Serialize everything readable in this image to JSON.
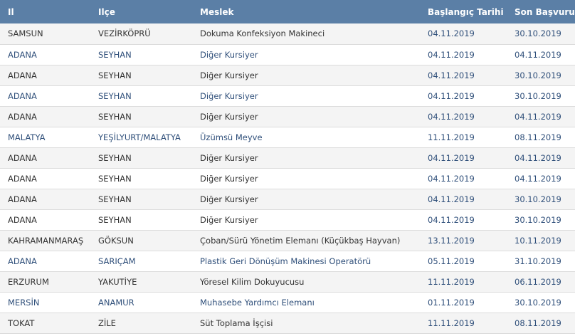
{
  "table": {
    "headers": [
      "Il",
      "Ilçe",
      "Meslek",
      "Başlangıç Tarihi",
      "Son Başvuru T"
    ],
    "rows": [
      {
        "il": "SAMSUN",
        "ilce": "VEZİRKÖPRÜ",
        "meslek": "Dokuma Konfeksiyon Makineci",
        "baslangic": "04.11.2019",
        "son_basvuru": "30.10.2019",
        "style": "dark"
      },
      {
        "il": "ADANA",
        "ilce": "SEYHAN",
        "meslek": "Diğer Kursiyer",
        "baslangic": "04.11.2019",
        "son_basvuru": "04.11.2019",
        "style": "link"
      },
      {
        "il": "ADANA",
        "ilce": "SEYHAN",
        "meslek": "Diğer Kursiyer",
        "baslangic": "04.11.2019",
        "son_basvuru": "30.10.2019",
        "style": "dark"
      },
      {
        "il": "ADANA",
        "ilce": "SEYHAN",
        "meslek": "Diğer Kursiyer",
        "baslangic": "04.11.2019",
        "son_basvuru": "30.10.2019",
        "style": "link"
      },
      {
        "il": "ADANA",
        "ilce": "SEYHAN",
        "meslek": "Diğer Kursiyer",
        "baslangic": "04.11.2019",
        "son_basvuru": "04.11.2019",
        "style": "dark"
      },
      {
        "il": "MALATYA",
        "ilce": "YEŞİLYURT/MALATYA",
        "meslek": "Üzümsü Meyve",
        "baslangic": "11.11.2019",
        "son_basvuru": "08.11.2019",
        "style": "link"
      },
      {
        "il": "ADANA",
        "ilce": "SEYHAN",
        "meslek": "Diğer Kursiyer",
        "baslangic": "04.11.2019",
        "son_basvuru": "04.11.2019",
        "style": "dark"
      },
      {
        "il": "ADANA",
        "ilce": "SEYHAN",
        "meslek": "Diğer Kursiyer",
        "baslangic": "04.11.2019",
        "son_basvuru": "04.11.2019",
        "style": "dark"
      },
      {
        "il": "ADANA",
        "ilce": "SEYHAN",
        "meslek": "Diğer Kursiyer",
        "baslangic": "04.11.2019",
        "son_basvuru": "30.10.2019",
        "style": "dark"
      },
      {
        "il": "ADANA",
        "ilce": "SEYHAN",
        "meslek": "Diğer Kursiyer",
        "baslangic": "04.11.2019",
        "son_basvuru": "30.10.2019",
        "style": "dark"
      },
      {
        "il": "KAHRAMANMARAŞ",
        "ilce": "GÖKSUN",
        "meslek": "Çoban/Sürü Yönetim Elemanı (Küçükbaş Hayvan)",
        "baslangic": "13.11.2019",
        "son_basvuru": "10.11.2019",
        "style": "dark"
      },
      {
        "il": "ADANA",
        "ilce": "SARIÇAM",
        "meslek": "Plastik Geri Dönüşüm Makinesi Operatörü",
        "baslangic": "05.11.2019",
        "son_basvuru": "31.10.2019",
        "style": "link"
      },
      {
        "il": "ERZURUM",
        "ilce": "YAKUTİYE",
        "meslek": "Yöresel Kilim Dokuyucusu",
        "baslangic": "11.11.2019",
        "son_basvuru": "06.11.2019",
        "style": "dark"
      },
      {
        "il": "MERSİN",
        "ilce": "ANAMUR",
        "meslek": "Muhasebe Yardımcı Elemanı",
        "baslangic": "01.11.2019",
        "son_basvuru": "30.10.2019",
        "style": "link"
      },
      {
        "il": "TOKAT",
        "ilce": "ZİLE",
        "meslek": "Süt Toplama İşçisi",
        "baslangic": "11.11.2019",
        "son_basvuru": "08.11.2019",
        "style": "dark"
      }
    ]
  },
  "colors": {
    "header_bg": "#5b7fa6",
    "header_text": "#ffffff",
    "row_alt": "#f4f4f4",
    "link_text": "#2f4f7a",
    "dark_text": "#333333"
  }
}
